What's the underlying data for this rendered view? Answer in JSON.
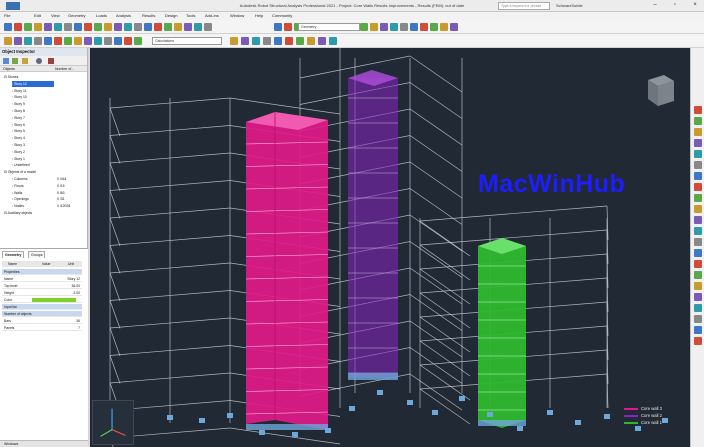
{
  "app": {
    "title": "Autodesk Robot Structural Analysis Professional 2021 - Project: Core Walls Results Improvements - Results (FEM): out of date",
    "search_placeholder": "Type a keyword or phrase",
    "user": "SchwarzSubtle"
  },
  "menu": [
    "File",
    "Edit",
    "View",
    "Geometry",
    "Loads",
    "Analysis",
    "Results",
    "Design",
    "Tools",
    "Add-Ins",
    "Window",
    "Help",
    "Community"
  ],
  "toolbar": {
    "calc_combo": "Calculations",
    "geometry_combo": "Geometry"
  },
  "inspector": {
    "title": "Object Inspector",
    "col_objects": "Objects",
    "col_number": "Number of...",
    "tree": [
      {
        "label": "Stories",
        "value": "",
        "indent": 0,
        "selected": false
      },
      {
        "label": "Story 12",
        "value": "",
        "indent": 1,
        "selected": true
      },
      {
        "label": "Story 11",
        "value": "",
        "indent": 1,
        "selected": false
      },
      {
        "label": "Story 10",
        "value": "",
        "indent": 1,
        "selected": false
      },
      {
        "label": "Story 9",
        "value": "",
        "indent": 1,
        "selected": false
      },
      {
        "label": "Story 8",
        "value": "",
        "indent": 1,
        "selected": false
      },
      {
        "label": "Story 7",
        "value": "",
        "indent": 1,
        "selected": false
      },
      {
        "label": "Story 6",
        "value": "",
        "indent": 1,
        "selected": false
      },
      {
        "label": "Story 5",
        "value": "",
        "indent": 1,
        "selected": false
      },
      {
        "label": "Story 4",
        "value": "",
        "indent": 1,
        "selected": false
      },
      {
        "label": "Story 3",
        "value": "",
        "indent": 1,
        "selected": false
      },
      {
        "label": "Story 2",
        "value": "",
        "indent": 1,
        "selected": false
      },
      {
        "label": "Story 1",
        "value": "",
        "indent": 1,
        "selected": false
      },
      {
        "label": "Undefined",
        "value": "",
        "indent": 1,
        "selected": false
      },
      {
        "label": "Objects of a model",
        "value": "",
        "indent": 0,
        "selected": false
      },
      {
        "label": "Columns",
        "value": "0 /444",
        "indent": 1,
        "selected": false
      },
      {
        "label": "Floors",
        "value": "0 /15",
        "indent": 1,
        "selected": false
      },
      {
        "label": "Walls",
        "value": "0 /63",
        "indent": 1,
        "selected": false
      },
      {
        "label": "Openings",
        "value": "0 /31",
        "indent": 1,
        "selected": false
      },
      {
        "label": "Nodes",
        "value": "0 /12028",
        "indent": 1,
        "selected": false
      },
      {
        "label": "Auxiliary objects",
        "value": "",
        "indent": 0,
        "selected": false
      }
    ]
  },
  "properties": {
    "tabs": [
      "Geometry",
      "Groups"
    ],
    "headers": [
      "Name",
      "Value",
      "Unit"
    ],
    "rows": [
      {
        "name": "Properties",
        "value": "",
        "section": true
      },
      {
        "name": "Name",
        "value": "Story 12",
        "section": false
      },
      {
        "name": "Top level",
        "value": "36.00",
        "section": false
      },
      {
        "name": "Height",
        "value": "3.00",
        "section": false
      },
      {
        "name": "Color",
        "value": "",
        "section": false,
        "swatch": "#7cd12a"
      },
      {
        "name": "Input list",
        "value": "",
        "section": true
      },
      {
        "name": "Number of objects",
        "value": "",
        "section": true
      },
      {
        "name": "Bars",
        "value": "36",
        "section": false
      },
      {
        "name": "Panels",
        "value": "7",
        "section": false
      }
    ]
  },
  "viewer": {
    "tabs": [
      "View",
      "Plan"
    ],
    "watermark": "MacWinHub"
  },
  "legend": [
    {
      "label": "Core wall 3",
      "color": "#e2198a"
    },
    {
      "label": "Core wall 2",
      "color": "#8a22c4"
    },
    {
      "label": "Core wall 1",
      "color": "#2fb82f"
    }
  ],
  "colors": {
    "viewport_bg": "#212a34",
    "frame": "#c9cfd8",
    "core_wall_3": "#e2198a",
    "core_wall_2": "#8a22c4",
    "core_wall_1": "#2fb82f",
    "supports": "#6ea8d8"
  },
  "status": {
    "tab": "Windows"
  }
}
